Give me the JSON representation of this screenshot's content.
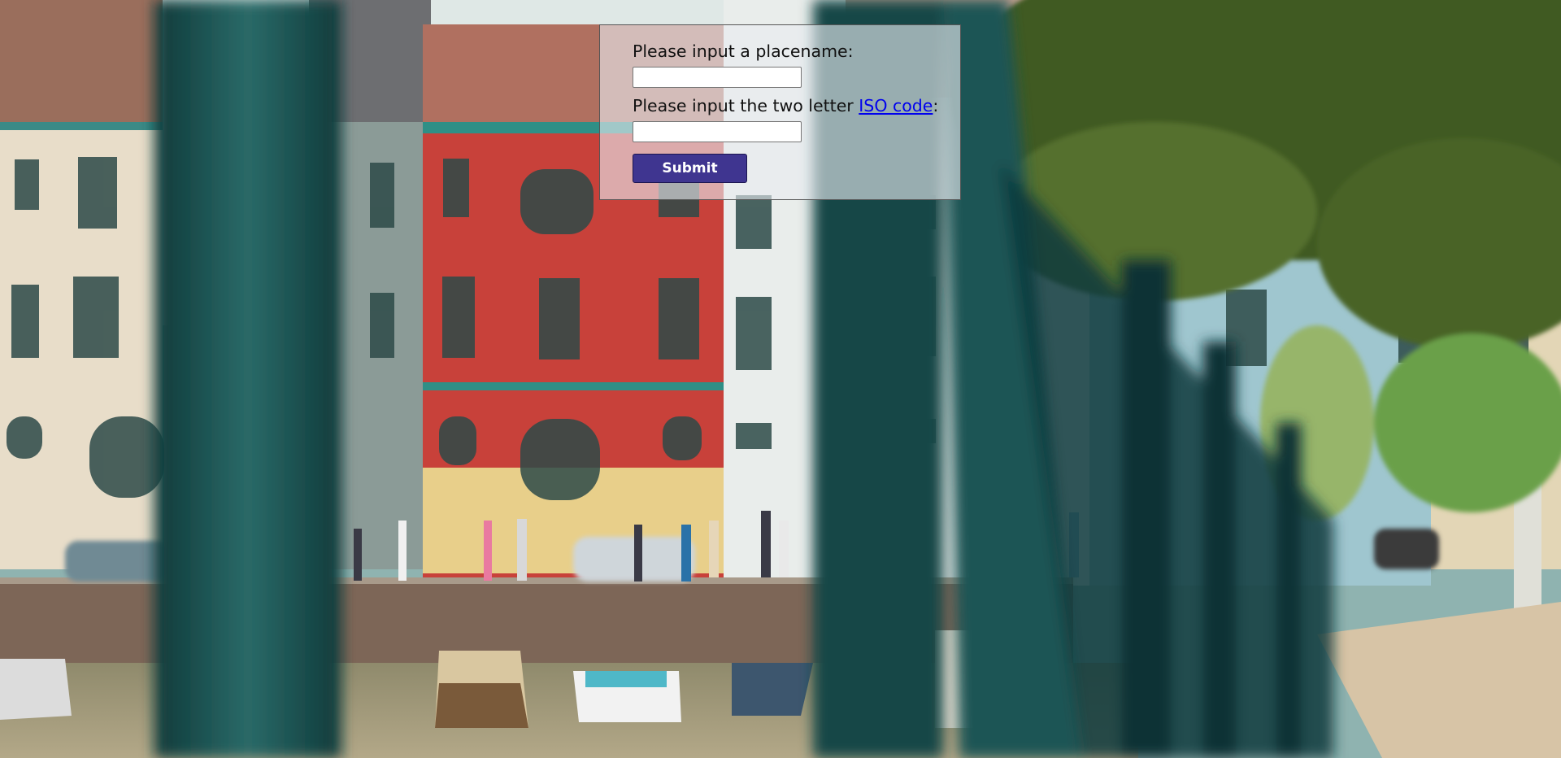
{
  "form": {
    "placename_label": "Please input a placename:",
    "placename_value": "",
    "iso_label_prefix": "Please input the two letter ",
    "iso_link_text": "ISO code",
    "iso_label_suffix": ":",
    "iso_value": "",
    "submit_label": "Submit"
  },
  "background": {
    "description_icon": "city-canal-photo",
    "colors": {
      "sky": "#dfe8e6",
      "red_facade": "#c8413a",
      "teal_trim": "#2f8f86",
      "railing": "#1d4f4f",
      "foliage": "#3f5a23",
      "water": "#a69a78",
      "button": "#3f3590"
    }
  }
}
